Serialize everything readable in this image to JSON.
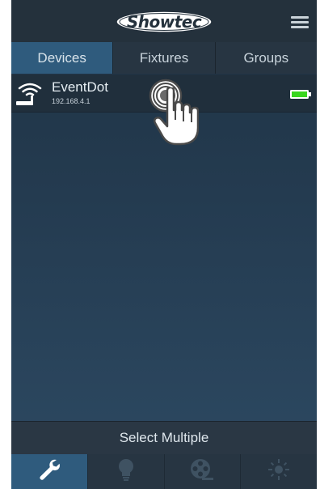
{
  "header": {
    "logo_text": "Showtec",
    "menu_icon": "hamburger-menu-icon"
  },
  "tabs": [
    {
      "label": "Devices",
      "active": true
    },
    {
      "label": "Fixtures",
      "active": false
    },
    {
      "label": "Groups",
      "active": false
    }
  ],
  "devices": [
    {
      "name": "EventDot",
      "ip": "192.168.4.1",
      "icon": "wifi-router-icon",
      "battery_icon": "battery-full-icon"
    }
  ],
  "footer": {
    "select_multiple_label": "Select Multiple"
  },
  "bottom_nav": [
    {
      "icon": "wrench-icon",
      "active": true
    },
    {
      "icon": "lightbulb-icon",
      "active": false
    },
    {
      "icon": "film-reel-icon",
      "active": false
    },
    {
      "icon": "sun-icon",
      "active": false
    }
  ],
  "colors": {
    "accent_active": "#2f5b7d",
    "battery_green": "#39d61e",
    "bar_dark": "#24313c"
  }
}
